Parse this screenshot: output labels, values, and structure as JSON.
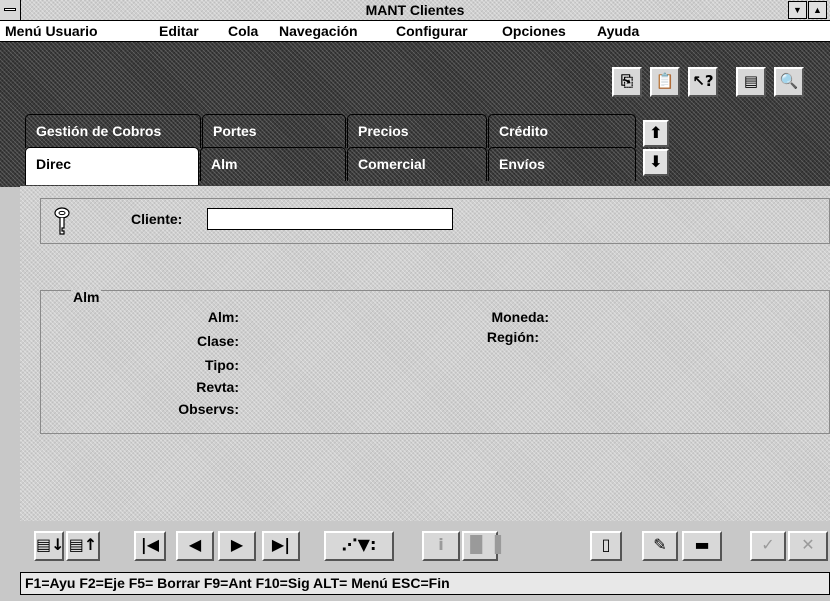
{
  "window": {
    "title": "MANT Clientes"
  },
  "menu": [
    {
      "label": "Menú Usuario"
    },
    {
      "label": "Editar"
    },
    {
      "label": "Cola"
    },
    {
      "label": "Navegación"
    },
    {
      "label": "Configurar"
    },
    {
      "label": "Opciones"
    },
    {
      "label": "Ayuda"
    }
  ],
  "toolbar_icons": [
    "copy-icon",
    "paste-icon",
    "help-pointer-icon",
    "notes-icon",
    "search-icon"
  ],
  "tabs": {
    "back_row": [
      "Gestión de Cobros",
      "Portes",
      "Precios",
      "Crédito"
    ],
    "front_row": [
      "Direc",
      "Alm",
      "Comercial",
      "Envíos"
    ],
    "active": "Direc"
  },
  "client": {
    "label": "Cliente:",
    "value": ""
  },
  "alm_group": {
    "title": "Alm",
    "left_fields": [
      "Alm:",
      "Clase:",
      "Tipo:",
      "Revta:",
      "Observs:"
    ],
    "right_fields": [
      "Moneda:",
      "Región:"
    ]
  },
  "nav_buttons": [
    {
      "icon": "table-down-icon"
    },
    {
      "icon": "table-up-icon"
    },
    {
      "icon": "first-record-icon"
    },
    {
      "icon": "previous-record-icon"
    },
    {
      "icon": "next-record-icon"
    },
    {
      "icon": "last-record-icon"
    },
    {
      "icon": "query-pointer-icon"
    },
    {
      "icon": "info-icon"
    },
    {
      "icon": "bar-chart-icon"
    },
    {
      "icon": "new-document-icon"
    },
    {
      "icon": "edit-pencil-icon"
    },
    {
      "icon": "delete-record-icon"
    },
    {
      "icon": "accept-check-icon"
    },
    {
      "icon": "cancel-x-icon"
    }
  ],
  "status": "F1=Ayu  F2=Eje  F5= Borrar  F9=Ant  F10=Sig  ALT= Menú ESC=Fin"
}
